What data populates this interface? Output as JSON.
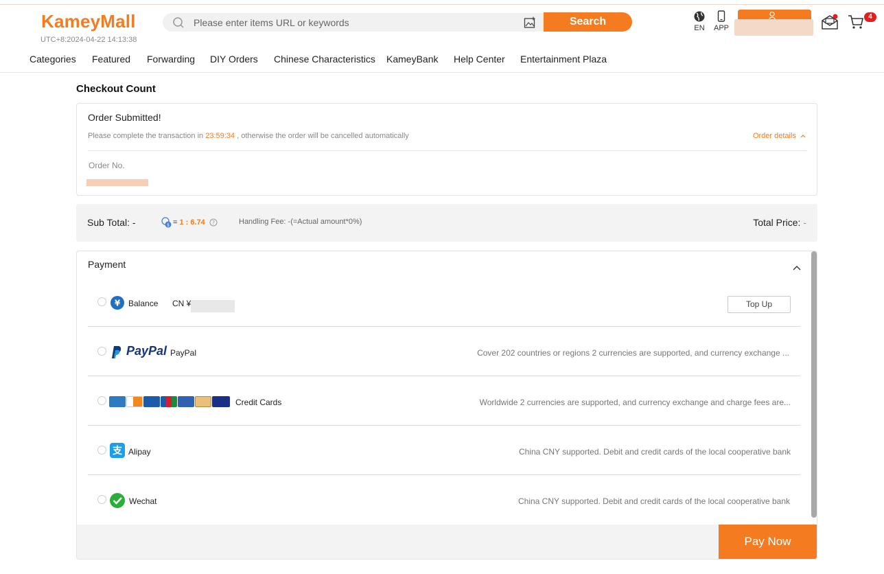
{
  "header": {
    "logo": "KameyMall",
    "timezone": "UTC+8:2024-04-22 14:13:38",
    "search_placeholder": "Please enter items URL or keywords",
    "search_button": "Search",
    "lang_label": "EN",
    "app_label": "APP",
    "cart_count": "4"
  },
  "nav": {
    "items": [
      "Categories",
      "Featured",
      "Forwarding",
      "DIY Orders",
      "Chinese Characteristics",
      "KameyBank",
      "Help Center",
      "Entertainment Plaza"
    ]
  },
  "page": {
    "title": "Checkout Count",
    "order": {
      "status": "Order Submitted!",
      "note_prefix": "Please complete the transaction in",
      "countdown": "23:59:34",
      "note_suffix": ", otherwise the order will be cancelled automatically",
      "details_link": "Order details",
      "order_no_label": "Order No."
    },
    "totals": {
      "subtotal": "Sub Total: -",
      "rate_prefix": "=",
      "rate": "1 : 6.74",
      "handling_fee": "Handling Fee: -(=Actual amount*0%)",
      "total_label": "Total Price:",
      "total_value": "-"
    },
    "payment": {
      "title": "Payment",
      "methods": [
        {
          "name": "Balance",
          "extra": "CN ¥",
          "action": "Top Up"
        },
        {
          "name": "PayPal",
          "logo_text": "PayPal",
          "desc": "Cover 202 countries or regions 2 currencies are supported, and currency exchange ..."
        },
        {
          "name": "Credit Cards",
          "desc": "Worldwide 2 currencies are supported, and currency exchange and charge fees are..."
        },
        {
          "name": "Alipay",
          "desc": "China CNY supported. Debit and credit cards of the local cooperative bank"
        },
        {
          "name": "Wechat",
          "desc": "China CNY supported. Debit and credit cards of the local cooperative bank"
        }
      ],
      "pay_now": "Pay Now"
    }
  },
  "colors": {
    "accent": "#f47b20",
    "badge": "#e02020"
  }
}
